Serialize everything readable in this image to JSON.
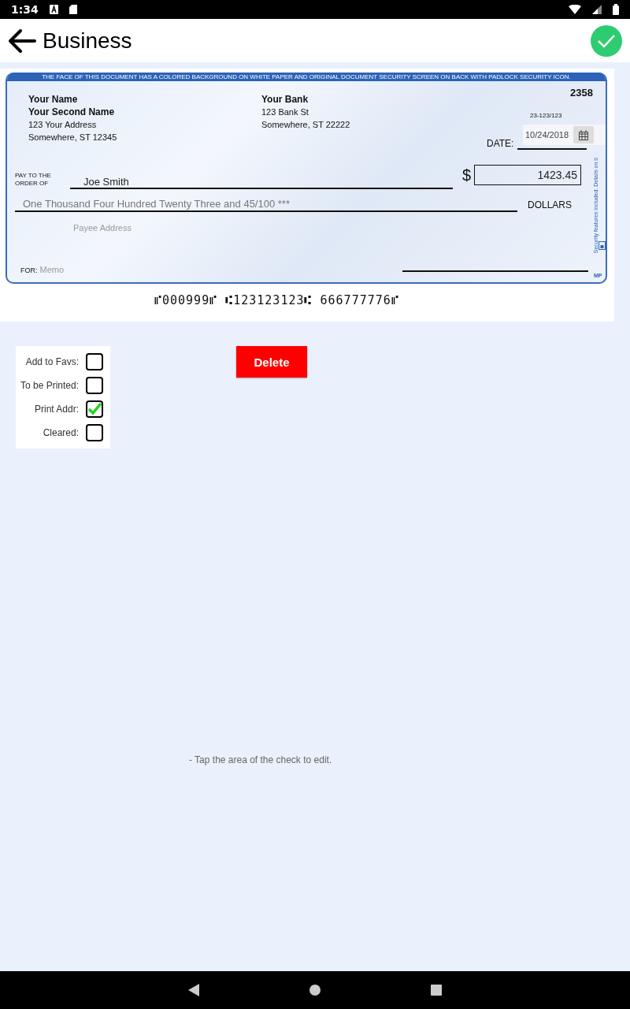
{
  "status_bar": {
    "time": "1:34"
  },
  "app_bar": {
    "title": "Business"
  },
  "check": {
    "banner": "THE FACE OF THIS DOCUMENT HAS A COLORED BACKGROUND ON WHITE PAPER AND ORIGINAL DOCUMENT SECURITY SCREEN ON BACK WITH PADLOCK SECURITY ICON.",
    "owner_lines": [
      "Your Name",
      "Your Second Name",
      "123 Your Address",
      "Somewhere, ST 12345"
    ],
    "bank_lines": [
      "Your Bank",
      "123 Bank St",
      "Somewhere, ST 22222"
    ],
    "check_number": "2358",
    "routing_fraction": "23-123/123",
    "date_label": "DATE:",
    "date": "10/24/2018",
    "pay_label": "PAY TO THE ORDER OF",
    "payee": "Joe Smith",
    "currency": "$",
    "amount": "1423.45",
    "amount_words": "One Thousand Four Hundred Twenty Three  and 45/100 ***",
    "dollars_label": "DOLLARS",
    "payee_address_placeholder": "Payee  Address",
    "for_label": "FOR:",
    "memo_placeholder": "Memo",
    "side_text": "Security features included. Details on b",
    "maker_mark": "MP",
    "micr_line": "⑈000999⑈ ⑆123123123⑆ 666777776⑈"
  },
  "options": [
    {
      "label": "Add to Favs:",
      "checked": false
    },
    {
      "label": "To be Printed:",
      "checked": false
    },
    {
      "label": "Print Addr:",
      "checked": true
    },
    {
      "label": "Cleared:",
      "checked": false
    }
  ],
  "delete_button": "Delete",
  "hint": "- Tap the area of the check to edit."
}
